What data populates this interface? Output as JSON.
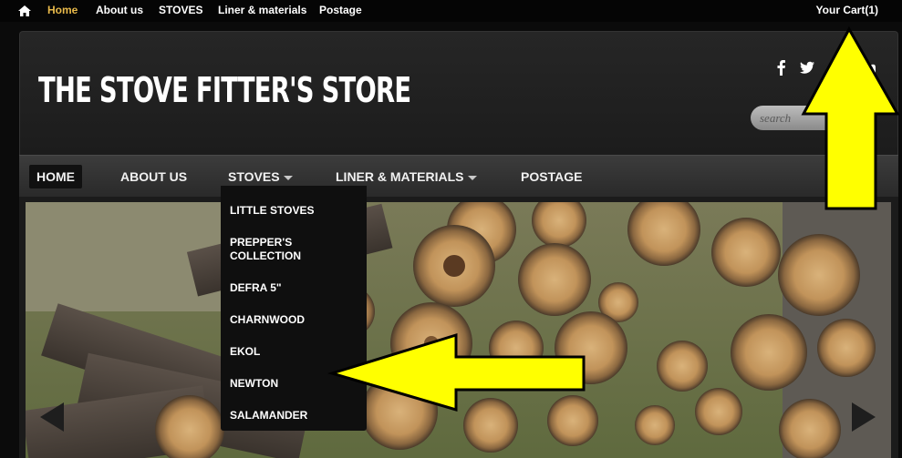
{
  "top_bar": {
    "links": [
      {
        "label": "Home",
        "active": true
      },
      {
        "label": "About us"
      },
      {
        "label": "STOVES"
      },
      {
        "label": "Liner & materials"
      },
      {
        "label": "Postage"
      }
    ],
    "cart_label": "Your Cart(1)"
  },
  "header": {
    "site_title": "THE STOVE FITTER'S STORE",
    "social_icons": [
      "facebook-icon",
      "twitter-icon",
      "linkedin-icon"
    ],
    "search_placeholder": "search"
  },
  "main_nav": {
    "items": [
      {
        "label": "HOME",
        "active": true
      },
      {
        "label": "ABOUT US"
      },
      {
        "label": "STOVES",
        "has_dropdown": true
      },
      {
        "label": "LINER & MATERIALS",
        "has_dropdown": true
      },
      {
        "label": "POSTAGE"
      }
    ]
  },
  "stoves_dropdown": {
    "items": [
      {
        "label": "LITTLE STOVES"
      },
      {
        "label": "PREPPER'S COLLECTION"
      },
      {
        "label": "DEFRA 5\""
      },
      {
        "label": "CHARNWOOD"
      },
      {
        "label": "EKOL"
      },
      {
        "label": "NEWTON"
      },
      {
        "label": "SALAMANDER"
      }
    ]
  },
  "colors": {
    "active_top_link": "#e8b94a",
    "annotation_arrow": "#ffff00"
  }
}
